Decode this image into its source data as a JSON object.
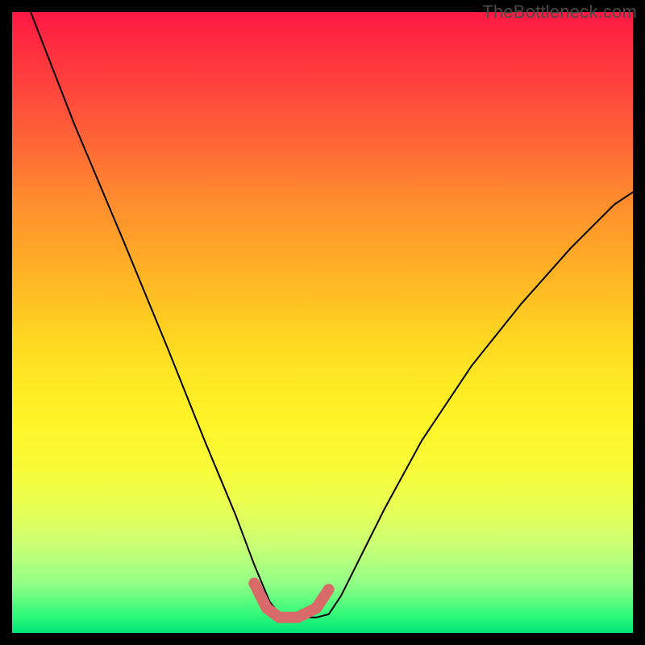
{
  "watermark": "TheBottleneck.com",
  "chart_data": {
    "type": "line",
    "title": "",
    "xlabel": "",
    "ylabel": "",
    "xlim": [
      0,
      100
    ],
    "ylim": [
      0,
      100
    ],
    "series": [
      {
        "name": "bottleneck-curve",
        "x": [
          3,
          10,
          18,
          25,
          31,
          36,
          39,
          41.5,
          43.5,
          46,
          49,
          51,
          53,
          56,
          60,
          66,
          74,
          82,
          90,
          97,
          100
        ],
        "y": [
          100,
          82,
          63,
          46,
          31,
          19,
          11,
          5,
          2.5,
          2.5,
          2.5,
          3,
          6,
          12,
          20,
          31,
          43,
          53,
          62,
          69,
          71
        ]
      }
    ],
    "trough_segment": {
      "name": "trough-highlight",
      "x": [
        39,
        41,
        43,
        46,
        49,
        51
      ],
      "y": [
        8,
        4,
        2.5,
        2.5,
        4,
        7
      ]
    },
    "colors": {
      "curve": "#000000",
      "trough": "#d96a6a",
      "background_top": "#ff1844",
      "background_bottom": "#00e676",
      "frame": "#000000"
    }
  }
}
